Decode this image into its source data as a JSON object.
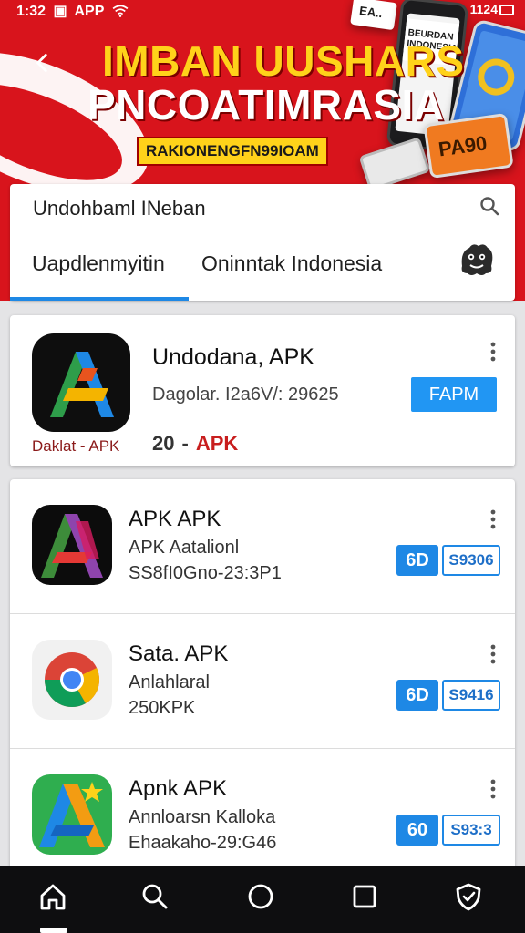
{
  "status_bar": {
    "time": "1:32",
    "left_extra": "APP",
    "right_text": "1124"
  },
  "banner": {
    "title_line1": "IMBAN UUSHARS",
    "title_line2": "PNCOATIMRASIA",
    "tagline": "RAKIONENGFN99IOAM",
    "phone_label": "BEURDAN INDONESIA",
    "tablet_label": "PA90",
    "corner_label": "EA..",
    "back_icon": "chevron-left-icon"
  },
  "search": {
    "query": "Undohbaml INeban",
    "icon": "search-icon",
    "tabs": [
      {
        "label": "Uapdlenmyitin",
        "active": true
      },
      {
        "label": "Oninntak Indonesia",
        "active": false
      }
    ],
    "avatar_icon": "monster-avatar-icon",
    "accent": "#1e88e5"
  },
  "featured": {
    "name": "Undodana, APK",
    "subtitle": "Dagolar. I2a6V/: 29625",
    "caption": "Daklat - APK",
    "rank_number": "20",
    "rank_separator": "-",
    "rank_label": "APK",
    "button_label": "FAPM",
    "more_icon": "more-vertical-icon"
  },
  "apps": [
    {
      "name": "APK APK",
      "line2": "APK Aatalionl",
      "line3": "SS8fI0Gno-23:3P1",
      "rating": "6D",
      "size": "S9306",
      "icon": "purple-a-app-icon"
    },
    {
      "name": "Sata. APK",
      "line2": "Anlahlaral",
      "line3": "250KPK",
      "rating": "6D",
      "size": "S9416",
      "icon": "chrome-icon"
    },
    {
      "name": "Apnk APK",
      "line2": "Annloarsn Kalloka",
      "line3": "Ehaakaho-29:G46",
      "rating": "60",
      "size": "S93:3",
      "icon": "star-a-app-icon"
    }
  ],
  "bottom_nav": [
    {
      "icon": "home-icon",
      "active": true
    },
    {
      "icon": "search-icon"
    },
    {
      "icon": "circle-icon"
    },
    {
      "icon": "square-icon"
    },
    {
      "icon": "shield-icon"
    }
  ]
}
